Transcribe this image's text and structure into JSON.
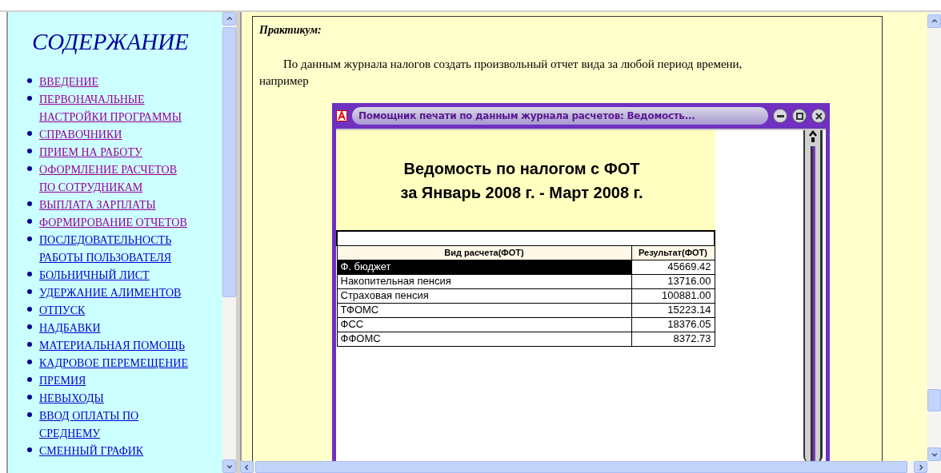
{
  "left_frame": {
    "heading": "СОДЕРЖАНИЕ",
    "items": [
      {
        "label": "ВВЕДЕНИЕ",
        "visited": true
      },
      {
        "label": "ПЕРВОНАЧАЛЬНЫЕ НАСТРОЙКИ ПРОГРАММЫ",
        "visited": true
      },
      {
        "label": "СПРАВОЧНИКИ",
        "visited": true
      },
      {
        "label": "ПРИЕМ НА РАБОТУ",
        "visited": true
      },
      {
        "label": "ОФОРМЛЕНИЕ РАСЧЕТОВ ПО СОТРУДНИКАМ",
        "visited": true
      },
      {
        "label": "ВЫПЛАТА ЗАРПЛАТЫ",
        "visited": true
      },
      {
        "label": "ФОРМИРОВАНИЕ ОТЧЕТОВ",
        "visited": true
      },
      {
        "label": "ПОСЛЕДОВАТЕЛЬНОСТЬ РАБОТЫ ПОЛЬЗОВАТЕЛЯ",
        "visited": false
      },
      {
        "label": "БОЛЬНИЧНЫЙ ЛИСТ",
        "visited": false
      },
      {
        "label": "УДЕРЖАНИЕ АЛИМЕНТОВ",
        "visited": false
      },
      {
        "label": "ОТПУСК",
        "visited": false
      },
      {
        "label": "НАДБАВКИ",
        "visited": false
      },
      {
        "label": "МАТЕРИАЛЬНАЯ ПОМОЩЬ",
        "visited": false
      },
      {
        "label": "КАДРОВОЕ ПЕРЕМЕЩЕНИЕ",
        "visited": false
      },
      {
        "label": "ПРЕМИЯ",
        "visited": false
      },
      {
        "label": "НЕВЫХОДЫ",
        "visited": false
      },
      {
        "label": "ВВОД ОПЛАТЫ ПО СРЕДНЕМУ",
        "visited": false
      },
      {
        "label": "СМЕННЫЙ ГРАФИК",
        "visited": false
      }
    ]
  },
  "right_frame": {
    "heading": "Практикум:",
    "paragraph": "По данным журнала налогов создать произвольный отчет вида за любой период времени, например",
    "report_window": {
      "title": "Помощник печати по данным журнала расчетов: Ведомость...",
      "report_title": "Ведомость по налогом с ФОТ",
      "report_period": "за Январь 2008 г. - Март 2008 г.",
      "columns": [
        "Вид расчета(ФОТ)",
        "Результат(ФОТ)"
      ],
      "rows": [
        {
          "cells": [
            "Ф. бюджет",
            "45669.42"
          ],
          "selected": true
        },
        {
          "cells": [
            "Накопительная пенсия",
            "13716.00"
          ],
          "selected": false
        },
        {
          "cells": [
            "Страховая пенсия",
            "100881.00"
          ],
          "selected": false
        },
        {
          "cells": [
            "ТФОМС",
            "15223.14"
          ],
          "selected": false
        },
        {
          "cells": [
            "ФСС",
            "18376.05"
          ],
          "selected": false
        },
        {
          "cells": [
            "ФФОМС",
            "8372.73"
          ],
          "selected": false
        }
      ]
    }
  }
}
